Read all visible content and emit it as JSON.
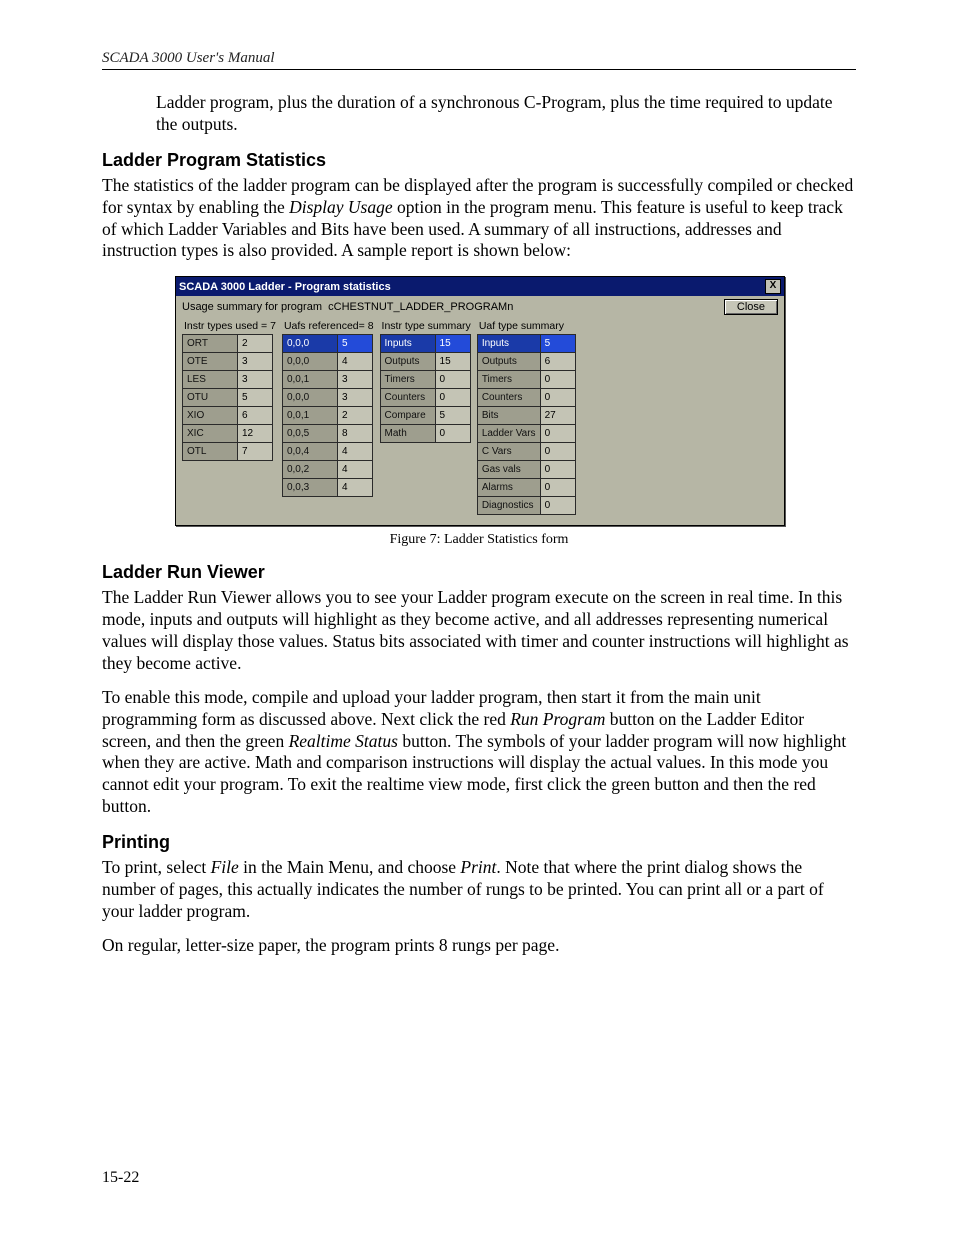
{
  "running_head": "SCADA 3000 User's Manual",
  "page_number": "15-22",
  "intro_para": "Ladder program, plus the duration of a synchronous C-Program, plus the time required to update the outputs.",
  "stats": {
    "heading": "Ladder Program Statistics",
    "para_parts": [
      "The statistics of the ladder program can be displayed after the program is successfully compiled or checked for syntax by enabling the ",
      "Display Usage",
      " option in the program menu. This feature is useful to keep track of which Ladder Variables and Bits have been used. A summary of all instructions, addresses and instruction types is also provided. A sample report is shown below:"
    ]
  },
  "fig": {
    "caption": "Figure 7: Ladder Statistics form",
    "titlebar": "SCADA 3000 Ladder - Program statistics",
    "toprow_label": "Usage summary for program",
    "toprow_value": "cCHESTNUT_LADDER_PROGRAMn",
    "close_label": "Close",
    "x_label": "X",
    "col1_head": "Instr types used = 7",
    "col2_head": "Uafs referenced= 8",
    "col3_head": "Instr type summary",
    "col4_head": "Uaf type summary",
    "col1": [
      {
        "l": "ORT",
        "v": "2"
      },
      {
        "l": "OTE",
        "v": "3"
      },
      {
        "l": "LES",
        "v": "3"
      },
      {
        "l": "OTU",
        "v": "5"
      },
      {
        "l": "XIO",
        "v": "6"
      },
      {
        "l": "XIC",
        "v": "12"
      },
      {
        "l": "OTL",
        "v": "7"
      }
    ],
    "col2": [
      {
        "l": "0,0,0",
        "v": "5",
        "hl": true
      },
      {
        "l": "0,0,0",
        "v": "4"
      },
      {
        "l": "0,0,1",
        "v": "3"
      },
      {
        "l": "0,0,0",
        "v": "3"
      },
      {
        "l": "0,0,1",
        "v": "2"
      },
      {
        "l": "0,0,5",
        "v": "8"
      },
      {
        "l": "0,0,4",
        "v": "4"
      },
      {
        "l": "0,0,2",
        "v": "4"
      },
      {
        "l": "0,0,3",
        "v": "4"
      }
    ],
    "col3": [
      {
        "l": "Inputs",
        "v": "15",
        "hl": true
      },
      {
        "l": "Outputs",
        "v": "15"
      },
      {
        "l": "Timers",
        "v": "0"
      },
      {
        "l": "Counters",
        "v": "0"
      },
      {
        "l": "Compare",
        "v": "5"
      },
      {
        "l": "Math",
        "v": "0"
      }
    ],
    "col4": [
      {
        "l": "Inputs",
        "v": "5",
        "hl": true
      },
      {
        "l": "Outputs",
        "v": "6"
      },
      {
        "l": "Timers",
        "v": "0"
      },
      {
        "l": "Counters",
        "v": "0"
      },
      {
        "l": "Bits",
        "v": "27"
      },
      {
        "l": "Ladder Vars",
        "v": "0"
      },
      {
        "l": "C Vars",
        "v": "0"
      },
      {
        "l": "Gas vals",
        "v": "0"
      },
      {
        "l": "Alarms",
        "v": "0"
      },
      {
        "l": "Diagnostics",
        "v": "0"
      }
    ]
  },
  "runviewer": {
    "heading": "Ladder Run Viewer",
    "p1": "The Ladder Run Viewer allows you to see your Ladder program execute on the screen in real time.  In this mode, inputs and outputs will highlight as they become active, and all addresses representing numerical values will display those values. Status bits associated with timer and counter instructions will highlight as they become active.",
    "p2_parts": [
      "To enable this mode, compile and upload your ladder program, then start it from the main unit programming form as discussed above. Next click the red ",
      "Run Program",
      " button on the Ladder Editor screen, and then the green ",
      "Realtime Status",
      " button. The symbols of your ladder program will now highlight when they are active. Math and comparison instructions will display the actual values.  In this mode you cannot edit your program. To exit the realtime view mode, first click the green button and then the red button."
    ]
  },
  "printing": {
    "heading": "Printing",
    "p1_parts": [
      "To print, select ",
      "File",
      " in the Main Menu, and choose ",
      "Print",
      ". Note that where the print dialog shows the number of pages, this actually indicates the number of rungs to be printed. You can print all or a part of your ladder program."
    ],
    "p2": "On regular, letter-size paper, the program prints 8 rungs per page."
  }
}
